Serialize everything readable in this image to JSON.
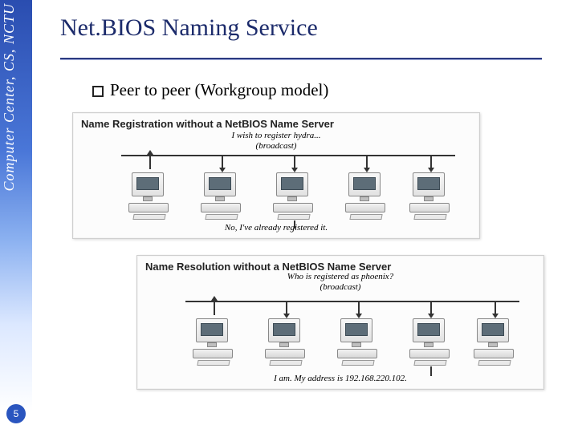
{
  "sidebar": {
    "org": "Computer Center, CS, NCTU"
  },
  "page_number": "5",
  "title": "Net.BIOS Naming Service",
  "bullet": "Peer to peer (Workgroup model)",
  "diagram1": {
    "title": "Name Registration without a NetBIOS Name Server",
    "speech_top": "I wish to register hydra...\n(broadcast)",
    "speech_bottom": "No, I've already registered it."
  },
  "diagram2": {
    "title": "Name Resolution without a NetBIOS Name Server",
    "speech_top": "Who is registered as phoenix?\n(broadcast)",
    "speech_bottom": "I am. My address is 192.168.220.102."
  }
}
